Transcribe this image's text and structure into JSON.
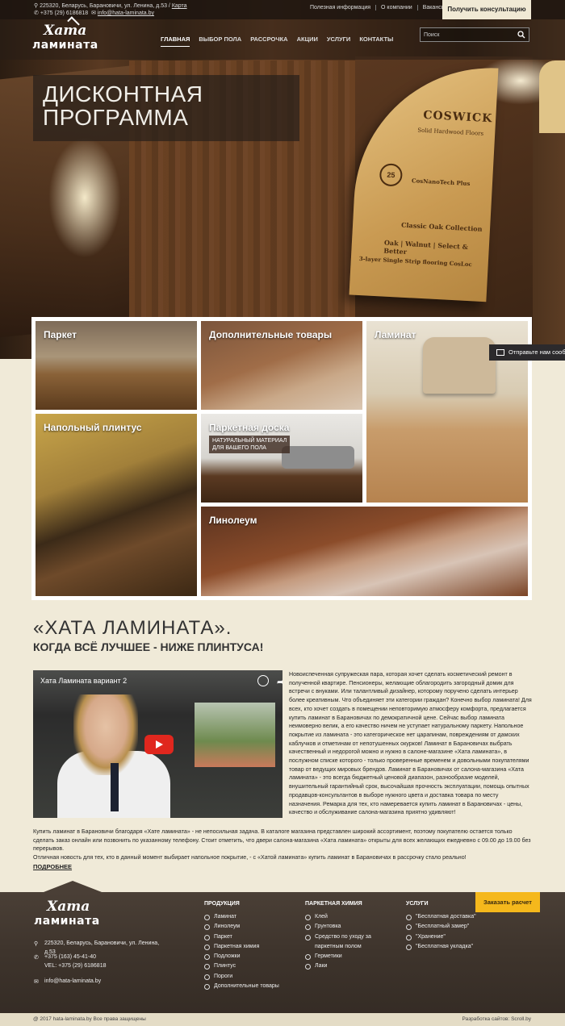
{
  "topbar": {
    "address": "225320, Беларусь, Барановичи, ул. Ленина, д.53 /",
    "map_link": "Карта",
    "phone": "+375 (29) 6186818",
    "email": "info@hata-laminata.by",
    "links": [
      "Полезная информация",
      "О компании",
      "Вакансии"
    ],
    "consult_button": "Получить консультацию"
  },
  "logo": {
    "line1": "Хата",
    "line2": "ламината"
  },
  "nav": {
    "items": [
      "ГЛАВНАЯ",
      "ВЫБОР ПОЛА",
      "РАССРОЧКА",
      "АКЦИИ",
      "УСЛУГИ",
      "КОНТАКТЫ"
    ],
    "active_index": 0
  },
  "search": {
    "placeholder": "Поиск"
  },
  "hero": {
    "title_line1": "ДИСКОНТНАЯ",
    "title_line2": "ПРОГРАММА",
    "sign": {
      "brand": "COSWICK",
      "sub": "Solid Hardwood Floors",
      "seal": "25",
      "tech": "CosNanoTech Plus",
      "collection": "Classic Oak Collection",
      "species": "Oak | Walnut | Select & Better",
      "layer": "3-layer Single Strip flooring CosLoc"
    }
  },
  "tiles": [
    {
      "label": "Паркет"
    },
    {
      "label": "Дополнительные товары"
    },
    {
      "label": "Ламинат"
    },
    {
      "label": "Напольный плинтус"
    },
    {
      "label": "Паркетная доска",
      "badge_line1": "НАТУРАЛЬНЫЙ МАТЕРИАЛ",
      "badge_line2": "ДЛЯ ВАШЕГО ПОЛА"
    },
    {
      "label": "Линолеум"
    }
  ],
  "feedback": {
    "label": "Отправьте нам сообщение"
  },
  "about": {
    "heading": "«ХАТА ЛАМИНАТА».",
    "subheading": "КОГДА ВСЁ ЛУЧШЕЕ - НИЖЕ ПЛИНТУСА!",
    "video_title": "Хата Ламината вариант 2",
    "paragraph1": "Новоиспеченная супружеская пара, которая хочет сделать косметический ремонт в полученной квартире. Пенсионеры, желающие облагородить загородный домик для встречи с внуками. Или талантливый дизайнер, которому поручено сделать интерьер более креативным. Что объединяет эти категории граждан? Конечно выбор ламината! Для всех, кто хочет создать в помещении неповторимую атмосферу комфорта, предлагается купить ламинат в Барановичах по демократичной цене. Сейчас выбор ламината неимоверно велик, а его качество ничем не уступает натуральному паркету. Напольное покрытие из ламината - это категорическое нет царапинам, повреждениям от дамских каблучков и отметинам от непотушенных окурков! Ламинат в Барановичах выбрать качественный и недорогой можно и нужно в салоне-магазине «Хата ламината», в послужном списке которого - только проверенные временем и довольными покупателями товар от ведущих мировых брендов. Ламинат в Барановичах от салона-магазина «Хата ламината» - это всегда бюджетный ценовой диапазон, разнообразие моделей, внушительный гарантийный срок, высочайшая прочность эксплуатации, помощь опытных продавцов-консультантов в выборе нужного цвета и доставка товара по месту назначения. Ремарка для тех, кто намеревается купить ламинат в Барановичах - цены, качество и обслуживание салона-магазина приятно удивляют!",
    "paragraph2": "Купить ламинат в Барановичи благодаря «Хате ламината» - не непосильная задача. В каталоге магазина представлен широкий ассортимент, поэтому покупателю остается только сделать заказ онлайн или позвонить по указанному телефону. Стоит отметить, что двери салона-магазина «Хата ламината» открыты для всех желающих ежедневно с 09.00 до 19.00 без перерывов.",
    "paragraph3": "Отличная новость для тех, кто в данный момент выбирает напольное покрытие, - с «Хатой ламината» купить ламинат в Барановичах в рассрочку стало реально!",
    "more_link": "ПОДРОБНЕЕ"
  },
  "footer": {
    "address": "225320, Беларусь, Барановичи, ул. Ленина, д.53",
    "phone1": "+375 (163) 45-41-40",
    "phone2": "VEL: +375 (29) 6186818",
    "email": "info@hata-laminata.by",
    "columns": [
      {
        "title": "ПРОДУКЦИЯ",
        "items": [
          "Ламинат",
          "Линолеум",
          "Паркет",
          "Паркетная химия",
          "Подложки",
          "Плинтус",
          "Пороги",
          "Дополнительные товары"
        ]
      },
      {
        "title": "ПАРКЕТНАЯ ХИМИЯ",
        "items": [
          "Клей",
          "Грунтовка",
          "Средство по уходу за паркетным полом",
          "Герметики",
          "Лаки"
        ]
      },
      {
        "title": "УСЛУГИ",
        "items": [
          "\"Бесплатная доставка\"",
          "\"Бесплатный замер\"",
          "\"Хранение\"",
          "\"Бесплатная укладка\""
        ]
      }
    ],
    "order_button": "Заказать расчет",
    "copyright": "@ 2017 hata-laminata.by Все права защищены",
    "developer": "Разработка сайтов: Scroll.by"
  }
}
